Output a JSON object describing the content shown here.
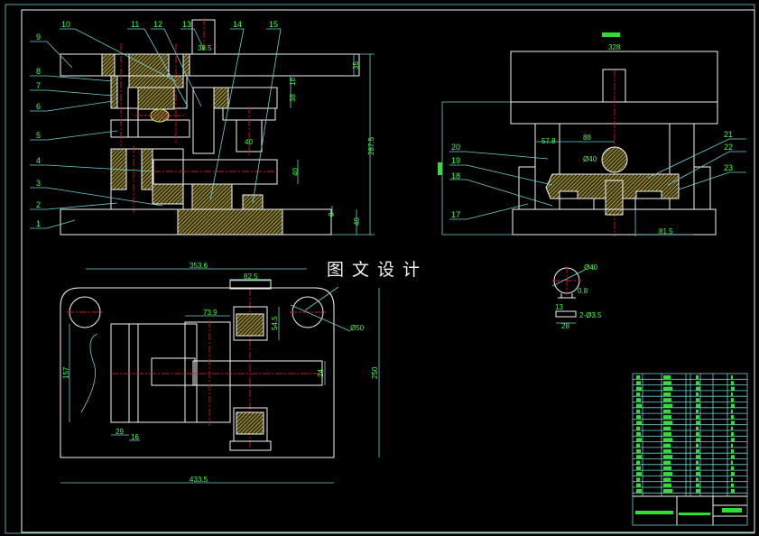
{
  "watermark": "图文设计",
  "colors": {
    "background": "#000000",
    "outline": "#f4f4f4",
    "leader": "#6fd0d0",
    "dimension_text": "#40ff40",
    "centerline": "#d01818",
    "hatch": "#e8d870"
  },
  "front_view": {
    "part_labels": [
      "1",
      "2",
      "3",
      "4",
      "5",
      "6",
      "7",
      "8",
      "9",
      "10",
      "11",
      "12",
      "13",
      "14",
      "15"
    ],
    "dims": {
      "shank": "38.5",
      "d35": "35",
      "d18": "18",
      "d38": "38",
      "d40a": "40",
      "d40b": "40",
      "d8": "8",
      "d40c": "40",
      "height": "287.5"
    }
  },
  "side_view": {
    "part_labels": [
      "17",
      "18",
      "19",
      "20",
      "21",
      "22",
      "23"
    ],
    "dims": {
      "width": "328",
      "d57": "57.8",
      "d88": "88",
      "ball": "Ø40",
      "d81": "81.5"
    }
  },
  "top_view": {
    "dims": {
      "centers": "353.6",
      "length": "433.5",
      "width": "250",
      "hole": "Ø50",
      "d82": "82.5",
      "d73": "73.9",
      "d54": "54.5",
      "d24": "24",
      "d157": "157",
      "d29": "29",
      "d16": "16"
    }
  },
  "detail_view": {
    "dims": {
      "dia": "Ø40",
      "thk": "0.8",
      "d13": "13",
      "holes": "2-Ø3.5",
      "d28": "28"
    }
  }
}
